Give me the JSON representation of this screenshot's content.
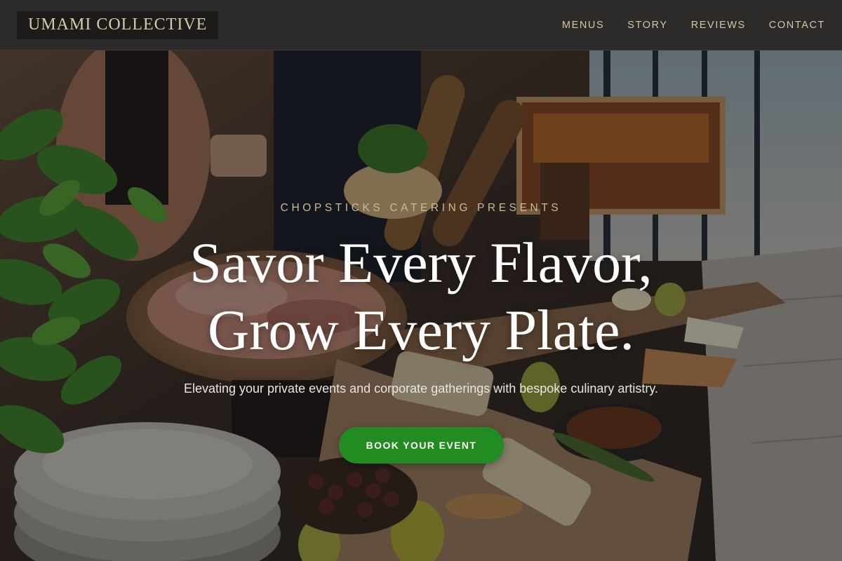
{
  "brand": {
    "name": "UMAMI COLLECTIVE"
  },
  "nav": {
    "items": [
      {
        "label": "MENUS"
      },
      {
        "label": "STORY"
      },
      {
        "label": "REVIEWS"
      },
      {
        "label": "CONTACT"
      }
    ]
  },
  "hero": {
    "eyebrow": "CHOPSTICKS CATERING PRESENTS",
    "headline_line1": "Savor Every Flavor,",
    "headline_line2": "Grow Every Plate.",
    "subheadline": "Elevating your private events and corporate gatherings with bespoke culinary artistry.",
    "cta_label": "BOOK YOUR EVENT"
  },
  "colors": {
    "header_bg": "#2c2b29",
    "accent_gold": "#d6c59f",
    "cta_green": "#228b22"
  }
}
